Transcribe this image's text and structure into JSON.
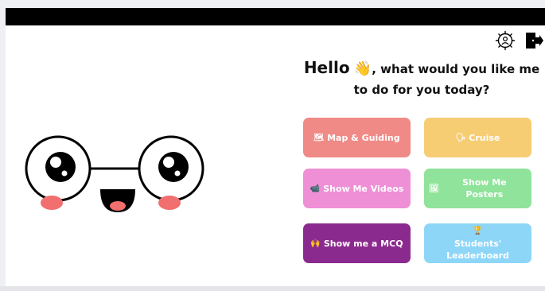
{
  "greeting": {
    "hello": "Hello",
    "wave_emoji": "👋",
    "line1_rest": ", what would you like me",
    "line2": "to do for you today?"
  },
  "header_icons": [
    {
      "name": "settings-icon"
    },
    {
      "name": "logout-icon"
    }
  ],
  "buttons": {
    "map_guiding": {
      "emoji": "🗺",
      "label": "Map & Guiding",
      "color": "#f08a86"
    },
    "cruise": {
      "emoji": "🗣",
      "label": "Cruise",
      "color": "#f6cd73"
    },
    "show_videos": {
      "emoji": "📹",
      "label": "Show Me Videos",
      "color": "#ef8fd6"
    },
    "show_posters": {
      "emoji": "🖼",
      "label": "Show Me Posters",
      "color": "#8fe39a"
    },
    "show_mcq": {
      "emoji": "🙌",
      "label": "Show me a MCQ",
      "color": "#8b2a8e"
    },
    "leaderboard": {
      "emoji": "🏆",
      "label": "Students' Leaderboard",
      "color": "#8dd6f7"
    }
  }
}
